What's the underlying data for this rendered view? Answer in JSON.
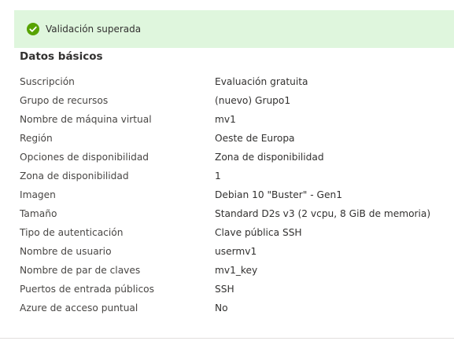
{
  "banner": {
    "icon": "check-circle-icon",
    "status_color": "#57a300",
    "background": "#dff6dd",
    "text": "Validación superada"
  },
  "section": {
    "title": "Datos básicos"
  },
  "rows": [
    {
      "label": "Suscripción",
      "value": "Evaluación gratuita"
    },
    {
      "label": "Grupo de recursos",
      "value": "(nuevo) Grupo1"
    },
    {
      "label": "Nombre de máquina virtual",
      "value": "mv1"
    },
    {
      "label": "Región",
      "value": "Oeste de Europa"
    },
    {
      "label": "Opciones de disponibilidad",
      "value": "Zona de disponibilidad"
    },
    {
      "label": "Zona de disponibilidad",
      "value": "1"
    },
    {
      "label": "Imagen",
      "value": "Debian 10 \"Buster\" - Gen1"
    },
    {
      "label": "Tamaño",
      "value": "Standard D2s v3 (2 vcpu, 8 GiB de memoria)"
    },
    {
      "label": "Tipo de autenticación",
      "value": "Clave pública SSH"
    },
    {
      "label": "Nombre de usuario",
      "value": "usermv1"
    },
    {
      "label": "Nombre de par de claves",
      "value": "mv1_key"
    },
    {
      "label": "Puertos de entrada públicos",
      "value": "SSH"
    },
    {
      "label": "Azure de acceso puntual",
      "value": "No"
    }
  ]
}
